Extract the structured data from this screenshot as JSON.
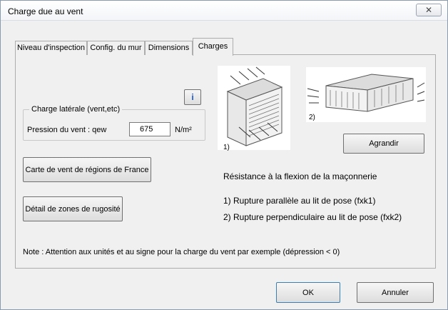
{
  "window": {
    "title": "Charge due au vent",
    "close_glyph": "✕"
  },
  "tabs": [
    {
      "label": "Niveau d'inspection"
    },
    {
      "label": "Config. du mur"
    },
    {
      "label": "Dimensions"
    },
    {
      "label": "Charges"
    }
  ],
  "charges": {
    "info_button": "i",
    "group_label": "Charge latérale (vent,etc)",
    "pressure_label": "Pression du vent : qew",
    "pressure_value": "675",
    "pressure_unit": "N/m²",
    "map_button": "Carte de vent de régions de France",
    "roughness_button": "Détail de zones de rugosité",
    "image1_label": "1)",
    "image2_label": "2)",
    "enlarge_button": "Agrandir",
    "resistance_title": "Résistance à la flexion de la maçonnerie",
    "rupture1": "1) Rupture parallèle au lit de pose (fxk1)",
    "rupture2": "2) Rupture perpendiculaire au lit de pose (fxk2)",
    "note": "Note : Attention aux unités et au signe pour la charge du vent par exemple (dépression < 0)"
  },
  "footer": {
    "ok": "OK",
    "cancel": "Annuler"
  }
}
